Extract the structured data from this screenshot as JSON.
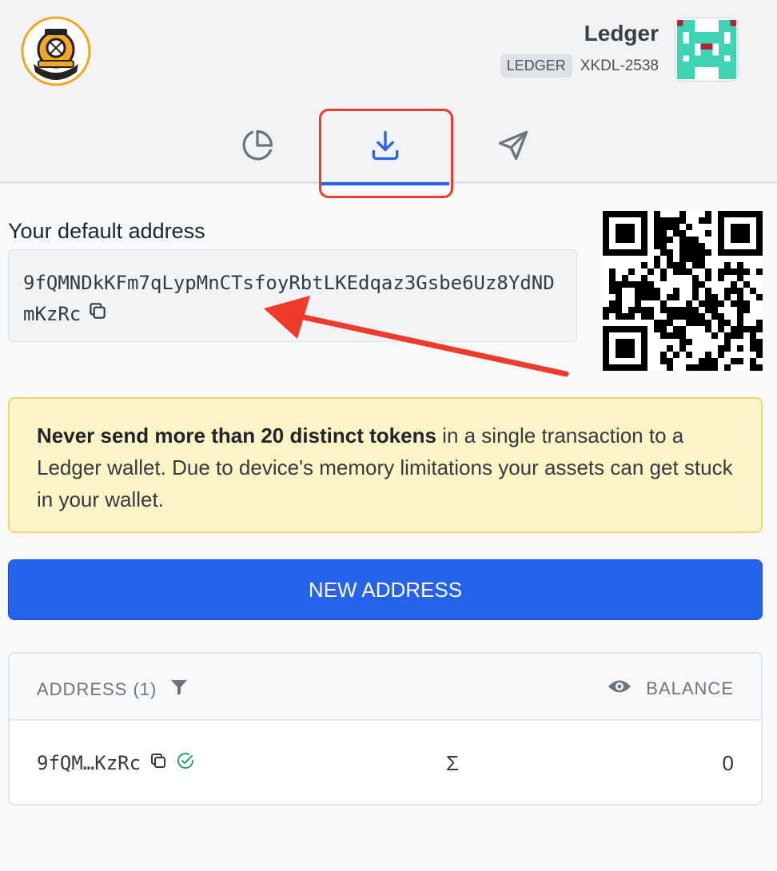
{
  "header": {
    "wallet_name": "Ledger",
    "wallet_type": "LEDGER",
    "wallet_id": "XKDL-2538"
  },
  "tabs": [
    {
      "name": "overview",
      "icon": "pie-chart-icon",
      "active": false
    },
    {
      "name": "receive",
      "icon": "download-icon",
      "active": true
    },
    {
      "name": "send",
      "icon": "send-icon",
      "active": false
    }
  ],
  "address_section": {
    "label": "Your default address",
    "address": "9fQMNDkKFm7qLypMnCTsfoyRbtLKEdqaz3Gsbe6Uz8YdNDmKzRc"
  },
  "warning": {
    "bold": "Never send more than 20 distinct tokens",
    "rest": " in a single transaction to a Ledger wallet. Due to device's memory limitations your assets can get stuck in your wallet."
  },
  "new_address_button": "NEW ADDRESS",
  "table": {
    "address_header": "ADDRESS (1)",
    "balance_header": "BALANCE",
    "rows": [
      {
        "address": "9fQM…KzRc",
        "symbol": "Σ",
        "balance": "0"
      }
    ]
  },
  "colors": {
    "accent": "#2563eb",
    "annotation": "#ef3b2c",
    "warning_bg": "#fdf4c7",
    "verified": "#2f9e6e"
  }
}
